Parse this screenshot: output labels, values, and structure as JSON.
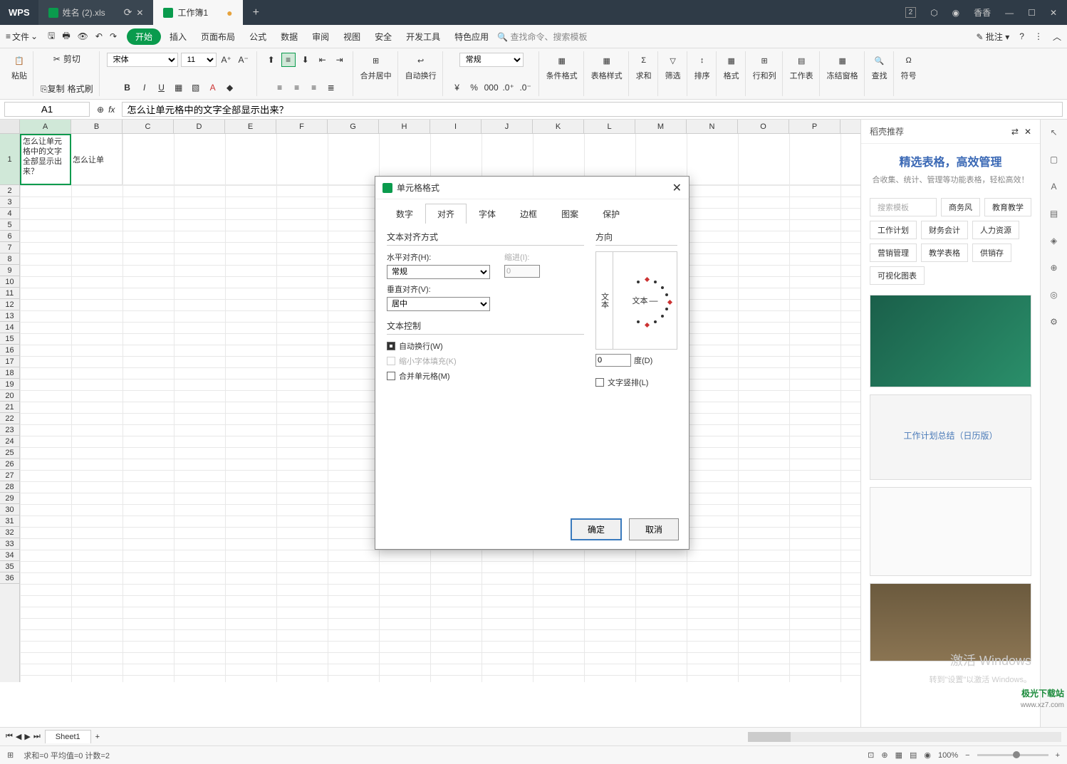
{
  "title_bar": {
    "logo": "WPS",
    "tabs": [
      {
        "label": "姓名 (2).xls",
        "active": false
      },
      {
        "label": "工作簿1",
        "active": true
      }
    ],
    "user": "香香"
  },
  "menu": {
    "file": "文件",
    "items": [
      "开始",
      "插入",
      "页面布局",
      "公式",
      "数据",
      "审阅",
      "视图",
      "安全",
      "开发工具",
      "特色应用"
    ],
    "active": "开始",
    "search": "查找命令、搜索模板",
    "comment": "批注"
  },
  "ribbon": {
    "paste": "粘贴",
    "cut": "剪切",
    "copy": "复制",
    "format_painter": "格式刷",
    "font_name": "宋体",
    "font_size": "11",
    "merge": "合并居中",
    "wrap": "自动换行",
    "num_format": "常规",
    "cond_format": "条件格式",
    "table_style": "表格样式",
    "sum": "求和",
    "filter": "筛选",
    "sort": "排序",
    "format": "格式",
    "row_col": "行和列",
    "worksheet": "工作表",
    "freeze": "冻结窗格",
    "find": "查找",
    "symbol": "符号"
  },
  "formula_bar": {
    "name_box": "A1",
    "formula": "怎么让单元格中的文字全部显示出来？"
  },
  "grid": {
    "columns": [
      "A",
      "B",
      "C",
      "D",
      "E",
      "F",
      "G",
      "H",
      "I",
      "J",
      "K",
      "L",
      "M",
      "N",
      "O",
      "P"
    ],
    "rows": [
      1,
      2,
      3,
      4,
      5,
      6,
      7,
      8,
      9,
      10,
      11,
      12,
      13,
      14,
      15,
      16,
      17,
      18,
      19,
      20,
      21,
      22,
      23,
      24,
      25,
      26,
      27,
      28,
      29,
      30,
      31,
      32,
      33,
      34,
      35,
      36
    ],
    "cell_a1": "怎么让单元格中的文字全部显示出来？",
    "cell_b1": "怎么让单"
  },
  "dialog": {
    "title": "单元格格式",
    "tabs": [
      "数字",
      "对齐",
      "字体",
      "边框",
      "图案",
      "保护"
    ],
    "active_tab": "对齐",
    "section_align": "文本对齐方式",
    "h_align_label": "水平对齐(H):",
    "h_align_value": "常规",
    "indent_label": "缩进(I):",
    "indent_value": "0",
    "v_align_label": "垂直对齐(V):",
    "v_align_value": "居中",
    "section_control": "文本控制",
    "wrap_text": "自动换行(W)",
    "shrink": "缩小字体填充(K)",
    "merge_cells": "合并单元格(M)",
    "section_orient": "方向",
    "orient_vert": "文本",
    "orient_text": "文本",
    "degree_value": "0",
    "degree_label": "度(D)",
    "vertical_text": "文字竖排(L)",
    "ok": "确定",
    "cancel": "取消"
  },
  "side_panel": {
    "header": "稻壳推荐",
    "promo_title": "精选表格，高效管理",
    "promo_sub": "合收集、统计、管理等功能表格，轻松高效！",
    "search_placeholder": "搜索模板",
    "tags": [
      "商务风",
      "教育教学",
      "工作计划",
      "财务会计",
      "人力资源",
      "营销管理",
      "教学表格",
      "供销存",
      "可视化图表"
    ],
    "tpl2_title": "工作计划总结（日历版）"
  },
  "sheet_tabs": {
    "active": "Sheet1"
  },
  "status_bar": {
    "stats": "求和=0  平均值=0  计数=2",
    "zoom": "100%"
  },
  "watermark": {
    "line1": "激活 Windows",
    "line2": "转到\"设置\"以激活 Windows。"
  },
  "site": {
    "name": "极光下载站",
    "url": "www.xz7.com"
  }
}
